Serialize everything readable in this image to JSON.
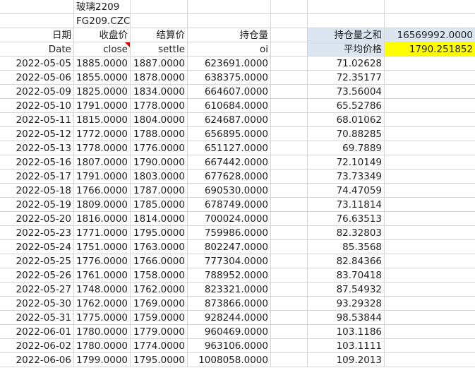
{
  "title_cn": "玻璃2209",
  "code": "FG209.CZC",
  "headers_cn": {
    "date": "日期",
    "close": "收盘价",
    "settle": "结算价",
    "oi": "持仓量"
  },
  "headers_en": {
    "date": "Date",
    "close": "close",
    "settle": "settle",
    "oi": "oi"
  },
  "summary": {
    "oi_sum_label": "持仓量之和",
    "oi_sum_value": "16569992.0000",
    "avg_price_label": "平均价格",
    "avg_price_value": "1790.251852"
  },
  "colors": {
    "header_fill": "#dce6f1",
    "highlight_fill": "#ffff00",
    "comment_mark": "#e00000"
  },
  "rows": [
    {
      "date": "2022-05-05",
      "close": "1885.0000",
      "settle": "1887.0000",
      "oi": "623691.0000",
      "ratio": "71.02628"
    },
    {
      "date": "2022-05-06",
      "close": "1855.0000",
      "settle": "1878.0000",
      "oi": "638375.0000",
      "ratio": "72.35177"
    },
    {
      "date": "2022-05-09",
      "close": "1825.0000",
      "settle": "1834.0000",
      "oi": "664607.0000",
      "ratio": "73.56004"
    },
    {
      "date": "2022-05-10",
      "close": "1791.0000",
      "settle": "1778.0000",
      "oi": "610684.0000",
      "ratio": "65.52786"
    },
    {
      "date": "2022-05-11",
      "close": "1815.0000",
      "settle": "1804.0000",
      "oi": "624687.0000",
      "ratio": "68.01062"
    },
    {
      "date": "2022-05-12",
      "close": "1772.0000",
      "settle": "1788.0000",
      "oi": "656895.0000",
      "ratio": "70.88285"
    },
    {
      "date": "2022-05-13",
      "close": "1778.0000",
      "settle": "1776.0000",
      "oi": "651127.0000",
      "ratio": "69.7889"
    },
    {
      "date": "2022-05-16",
      "close": "1807.0000",
      "settle": "1790.0000",
      "oi": "667442.0000",
      "ratio": "72.10149"
    },
    {
      "date": "2022-05-17",
      "close": "1791.0000",
      "settle": "1803.0000",
      "oi": "677628.0000",
      "ratio": "73.73349"
    },
    {
      "date": "2022-05-18",
      "close": "1766.0000",
      "settle": "1787.0000",
      "oi": "690530.0000",
      "ratio": "74.47059"
    },
    {
      "date": "2022-05-19",
      "close": "1809.0000",
      "settle": "1785.0000",
      "oi": "678749.0000",
      "ratio": "73.11814"
    },
    {
      "date": "2022-05-20",
      "close": "1816.0000",
      "settle": "1814.0000",
      "oi": "700024.0000",
      "ratio": "76.63513"
    },
    {
      "date": "2022-05-23",
      "close": "1771.0000",
      "settle": "1795.0000",
      "oi": "759986.0000",
      "ratio": "82.32803"
    },
    {
      "date": "2022-05-24",
      "close": "1751.0000",
      "settle": "1763.0000",
      "oi": "802247.0000",
      "ratio": "85.3568"
    },
    {
      "date": "2022-05-25",
      "close": "1776.0000",
      "settle": "1766.0000",
      "oi": "777304.0000",
      "ratio": "82.84366"
    },
    {
      "date": "2022-05-26",
      "close": "1761.0000",
      "settle": "1758.0000",
      "oi": "788952.0000",
      "ratio": "83.70418"
    },
    {
      "date": "2022-05-27",
      "close": "1748.0000",
      "settle": "1762.0000",
      "oi": "823321.0000",
      "ratio": "87.54932"
    },
    {
      "date": "2022-05-30",
      "close": "1762.0000",
      "settle": "1769.0000",
      "oi": "873866.0000",
      "ratio": "93.29328"
    },
    {
      "date": "2022-05-31",
      "close": "1775.0000",
      "settle": "1759.0000",
      "oi": "928244.0000",
      "ratio": "98.53844"
    },
    {
      "date": "2022-06-01",
      "close": "1780.0000",
      "settle": "1779.0000",
      "oi": "960469.0000",
      "ratio": "103.1186"
    },
    {
      "date": "2022-06-02",
      "close": "1780.0000",
      "settle": "1774.0000",
      "oi": "963106.0000",
      "ratio": "103.1111"
    },
    {
      "date": "2022-06-06",
      "close": "1799.0000",
      "settle": "1795.0000",
      "oi": "1008058.0000",
      "ratio": "109.2013"
    }
  ]
}
